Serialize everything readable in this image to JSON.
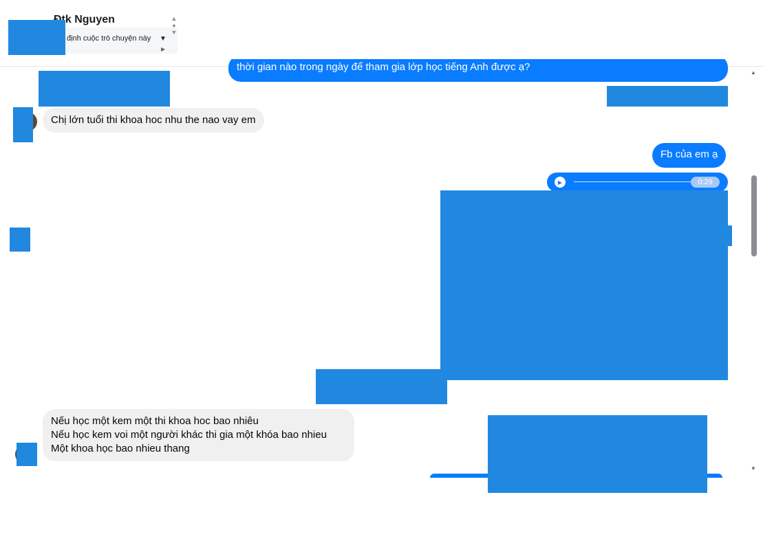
{
  "header": {
    "contact_name": "Đtk Nguyen",
    "conversation_subtitle": "định cuộc trò chuyện này",
    "toolbar": [
      {
        "name": "report-button",
        "icon": "exclamation-circle-icon",
        "glyph": "❗"
      },
      {
        "name": "delete-button",
        "icon": "trash-icon",
        "glyph": "🗑"
      },
      {
        "name": "star-button",
        "icon": "star-icon",
        "glyph": "★"
      },
      {
        "name": "mark-unread-button",
        "icon": "envelope-icon",
        "glyph": "✉"
      },
      {
        "name": "important-button",
        "icon": "exclamation-icon",
        "glyph": "!"
      },
      {
        "name": "done-button",
        "icon": "check-icon",
        "glyph": "✓"
      }
    ]
  },
  "messages": {
    "m1_outgoing": "thời gian nào trong ngày để tham gia lớp học tiếng Anh được ạ?",
    "m2_incoming": "Chị lớn tuổi thi khoa hoc nhu the nao vay em",
    "m3_outgoing": "Fb của em ạ",
    "m4_audio_duration": "0:29",
    "m5_incoming_lines": [
      "Nếu học một kem một thi khoa hoc bao nhiêu",
      "Nếu học kem voi một người khác thi gia một khóa bao nhieu",
      "Một khoa học bao nhieu thang"
    ]
  },
  "colors": {
    "outgoing_bubble": "#0a7cff",
    "incoming_bubble": "#f0f0f0",
    "redaction": "#2188e0"
  }
}
